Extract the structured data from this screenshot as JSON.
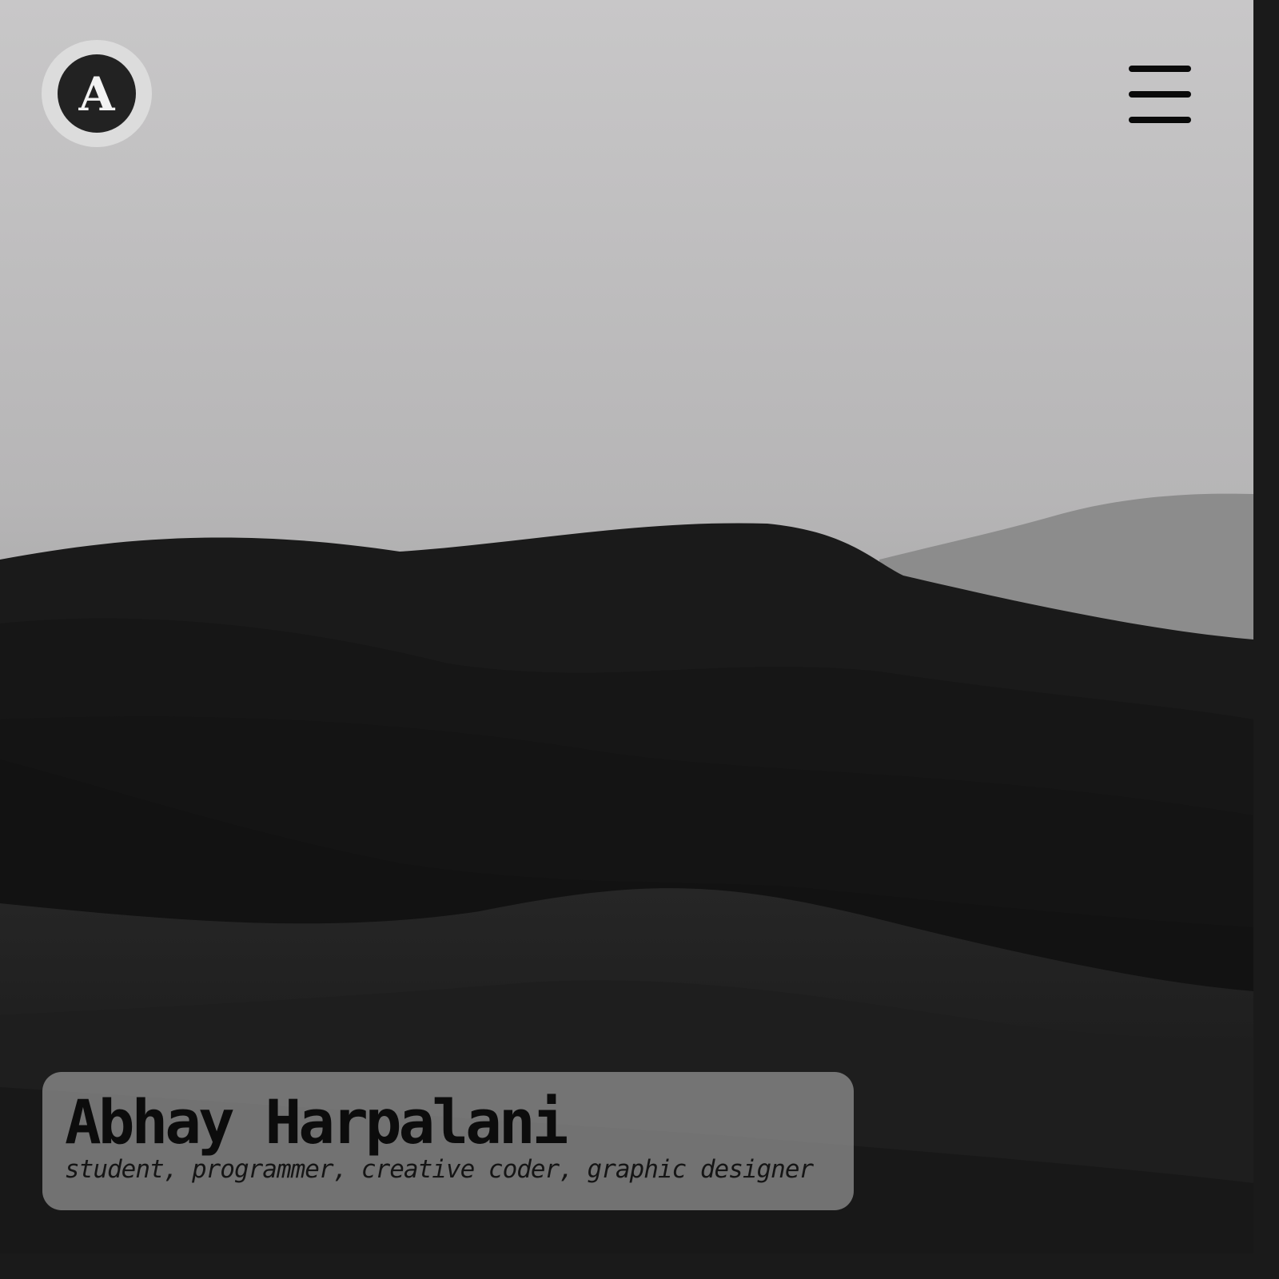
{
  "header": {
    "logo_letter": "A"
  },
  "hero": {
    "name": "Abhay Harpalani",
    "tagline": "student, programmer, creative coder, graphic designer"
  },
  "colors": {
    "sky": "#c9c8c9",
    "dunes": "#141414",
    "card": "#aaaaaa",
    "text": "#0c0c0c"
  },
  "icons": {
    "menu": "hamburger-menu-icon",
    "logo": "letter-a-logo"
  }
}
